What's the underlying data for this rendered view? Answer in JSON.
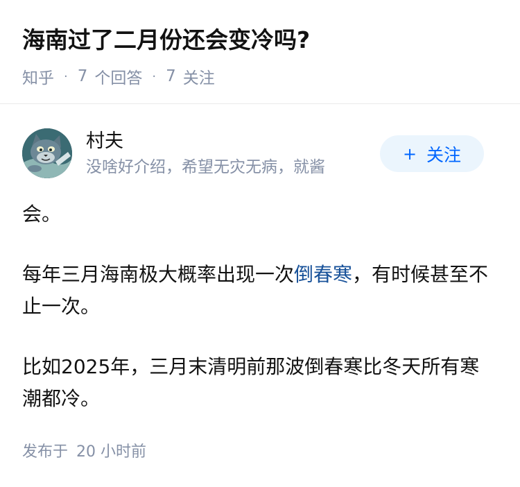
{
  "question": {
    "title": "海南过了二月份还会变冷吗?",
    "source": "知乎",
    "answers_count": "7",
    "answers_label": "个回答",
    "followers_count": "7",
    "followers_label": "关注"
  },
  "author": {
    "name": "村夫",
    "bio": "没啥好介绍，希望无灾无病，就酱",
    "avatar_icon": "cat-cartoon-avatar",
    "follow_label": "关注",
    "follow_icon": "plus-icon"
  },
  "answer": {
    "paragraph_1": "会。",
    "paragraph_2_before": "每年三月海南极大概率出现一次",
    "paragraph_2_link": "倒春寒",
    "paragraph_2_after": "，有时候甚至不止一次。",
    "paragraph_3": "比如2025年，三月末清明前那波倒春寒比冬天所有寒潮都冷。"
  },
  "footer": {
    "publish_prefix": "发布于",
    "publish_time": "20 小时前"
  },
  "colors": {
    "primary_text": "#121212",
    "secondary_text": "#8590a6",
    "link": "#175199",
    "follow_text": "#0066ff",
    "follow_bg": "#ebf5fd"
  }
}
